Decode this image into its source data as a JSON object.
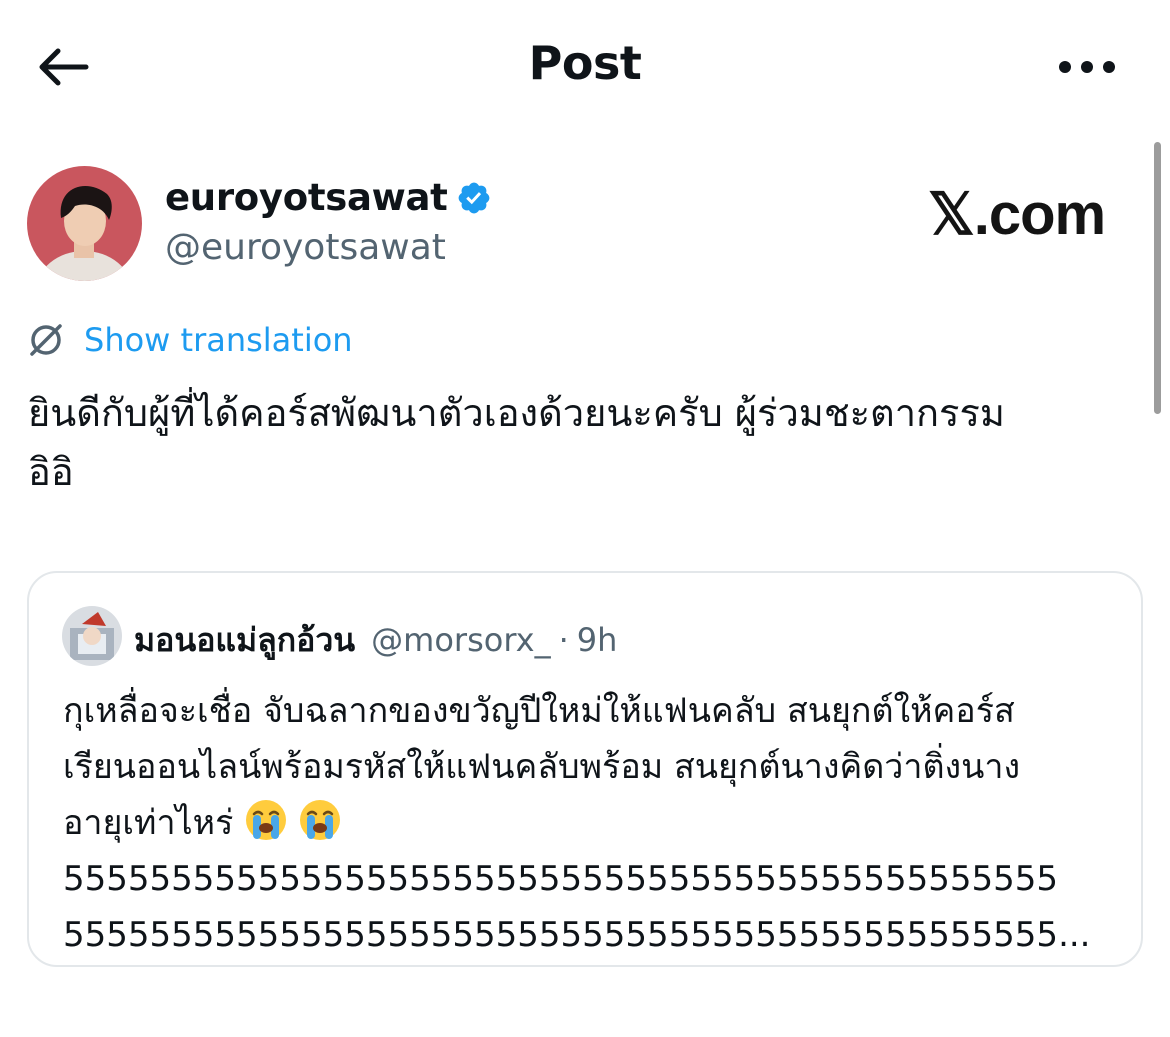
{
  "header": {
    "title": "Post",
    "back_icon": "arrow-left-icon",
    "more_icon": "more-horizontal-icon"
  },
  "author": {
    "name": "euroyotsawat",
    "handle": "@euroyotsawat",
    "verified": true,
    "verified_color": "#1d9bf0"
  },
  "watermark": {
    "label": "𝕏.com"
  },
  "translation": {
    "label": "Show translation",
    "color": "#1d9bf0"
  },
  "post": {
    "text": "ยินดีกับผู้ที่ได้คอร์สพัฒนาตัวเองด้วยนะครับ ผู้ร่วมชะตากรรม\nอิอิ"
  },
  "quote": {
    "name": "มอนอแม่ลูกอ้วน",
    "handle": "@morsorx_",
    "separator": "·",
    "time": "9h",
    "text_before_emoji": "กุเหลื่อจะเชื่อ จับฉลากของขวัญปีใหม่ให้แฟนคลับ สนยุกต์ให้คอร์ส\nเรียนออนไลน์พร้อมรหัสให้แฟนคลับพร้อม สนยุกต์นางคิดว่าติ่งนาง\nอายุเท่าไหร่ ",
    "emojis": [
      "😭",
      "😭"
    ],
    "text_after_emoji": "\n5555555555555555555555555555555555555555555555\n5555555555555555555555555555555555555555555555..."
  },
  "colors": {
    "text_primary": "#0f1419",
    "text_secondary": "#536471",
    "border": "#e3e7ea"
  }
}
